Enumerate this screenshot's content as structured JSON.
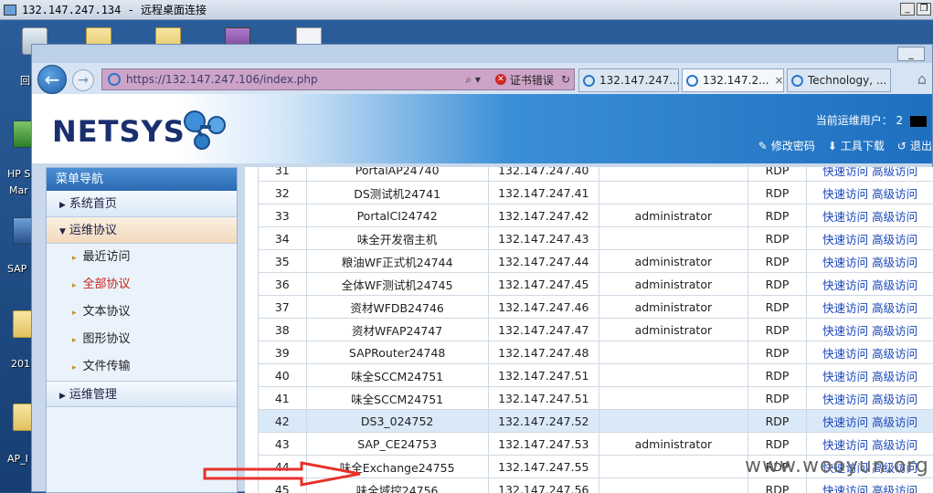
{
  "rdp": {
    "title": "132.147.247.134 - 远程桌面连接",
    "min": "_",
    "restore": "❐"
  },
  "desktop": {
    "labels": {
      "recycle": "回",
      "hp": "HP S",
      "hp2": "Mar",
      "sap": "SAP",
      "folder_201": "201",
      "ap": "AP_I"
    }
  },
  "browser": {
    "min_label": "_",
    "url": "https://132.147.247.106/index.php",
    "cert_error": "证书错误",
    "tabs": [
      "132.147.247....",
      "132.147.2...",
      "Technology, ..."
    ],
    "tab_close": "×"
  },
  "header": {
    "logo": "NETSYS",
    "current_user_label": "当前运维用户：",
    "current_user_initial": "2",
    "change_password": "修改密码",
    "tool_download": "工具下载",
    "logout": "退出"
  },
  "sidebar": {
    "title": "菜单导航",
    "sections": {
      "home": "系统首页",
      "protocols": "运维协议",
      "management": "运维管理"
    },
    "items": [
      "最近访问",
      "全部协议",
      "文本协议",
      "图形协议",
      "文件传输"
    ]
  },
  "table": {
    "quick": "快速访问",
    "advanced": "高级访问",
    "rows": [
      {
        "id": "31",
        "name": "PortalAP24740",
        "ip": "132.147.247.40",
        "user": "",
        "proto": "RDP"
      },
      {
        "id": "32",
        "name": "DS测试机24741",
        "ip": "132.147.247.41",
        "user": "",
        "proto": "RDP"
      },
      {
        "id": "33",
        "name": "PortalCI24742",
        "ip": "132.147.247.42",
        "user": "administrator",
        "proto": "RDP"
      },
      {
        "id": "34",
        "name": "味全开发宿主机",
        "ip": "132.147.247.43",
        "user": "",
        "proto": "RDP"
      },
      {
        "id": "35",
        "name": "粮油WF正式机24744",
        "ip": "132.147.247.44",
        "user": "administrator",
        "proto": "RDP"
      },
      {
        "id": "36",
        "name": "全体WF测试机24745",
        "ip": "132.147.247.45",
        "user": "administrator",
        "proto": "RDP"
      },
      {
        "id": "37",
        "name": "资材WFDB24746",
        "ip": "132.147.247.46",
        "user": "administrator",
        "proto": "RDP"
      },
      {
        "id": "38",
        "name": "资材WFAP24747",
        "ip": "132.147.247.47",
        "user": "administrator",
        "proto": "RDP"
      },
      {
        "id": "39",
        "name": "SAPRouter24748",
        "ip": "132.147.247.48",
        "user": "",
        "proto": "RDP"
      },
      {
        "id": "40",
        "name": "味全SCCM24751",
        "ip": "132.147.247.51",
        "user": "",
        "proto": "RDP"
      },
      {
        "id": "41",
        "name": "味全SCCM24751",
        "ip": "132.147.247.51",
        "user": "",
        "proto": "RDP"
      },
      {
        "id": "42",
        "name": "DS3_024752",
        "ip": "132.147.247.52",
        "user": "",
        "proto": "RDP"
      },
      {
        "id": "43",
        "name": "SAP_CE24753",
        "ip": "132.147.247.53",
        "user": "administrator",
        "proto": "RDP"
      },
      {
        "id": "44",
        "name": "味全Exchange24755",
        "ip": "132.147.247.55",
        "user": "",
        "proto": "RDP"
      },
      {
        "id": "45",
        "name": "味全域控24756",
        "ip": "132.147.247.56",
        "user": "",
        "proto": "RDP"
      }
    ]
  },
  "watermark": "www.wooyun.org",
  "colors": {
    "accent": "#2a6ab0",
    "link": "#1a46b8",
    "active_menu": "#c8241b",
    "arrow": "#e8312b"
  }
}
